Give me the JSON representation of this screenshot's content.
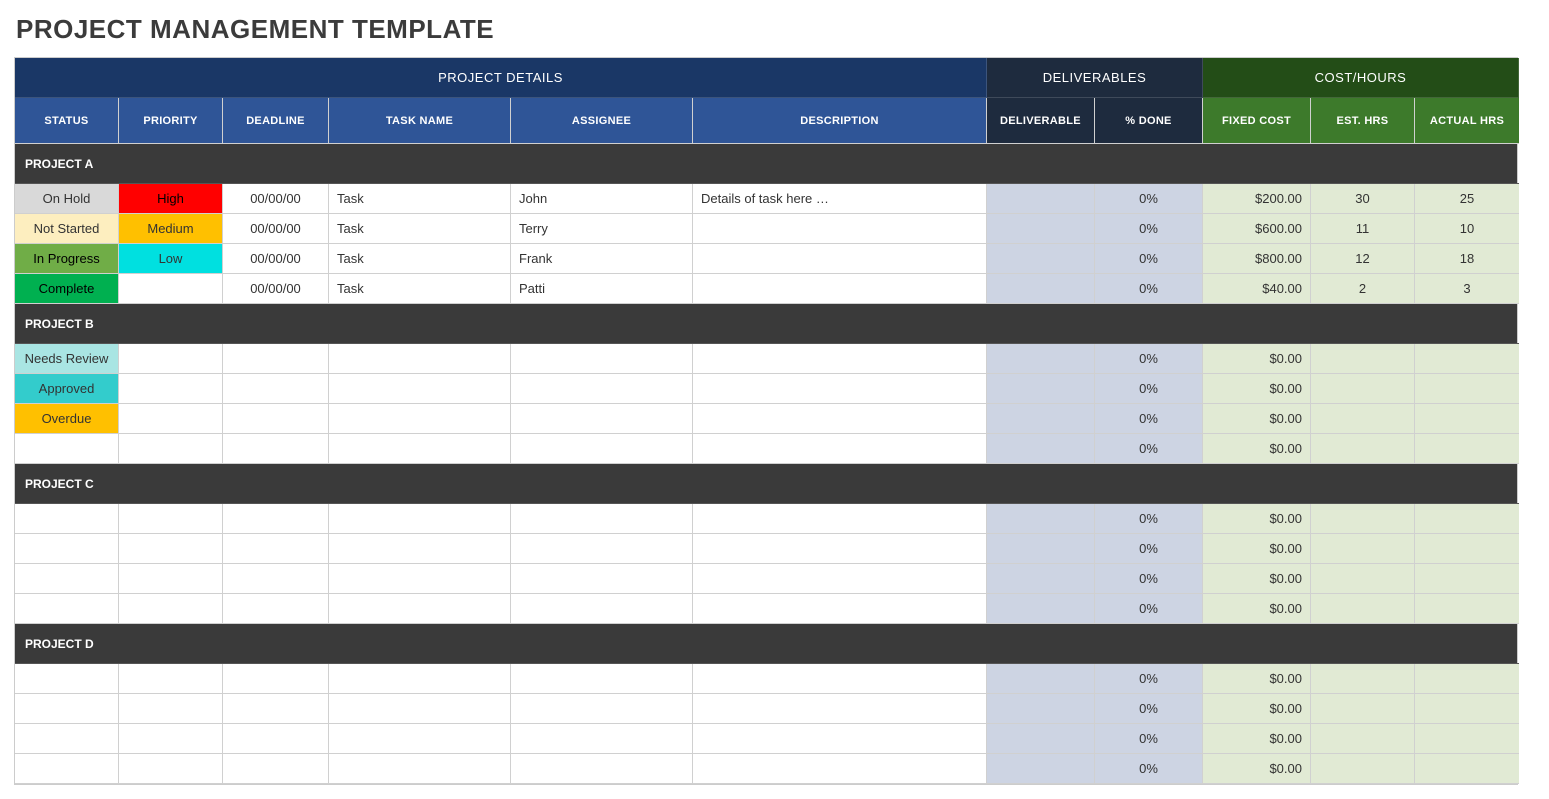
{
  "title": "PROJECT MANAGEMENT TEMPLATE",
  "bands": {
    "pd": "PROJECT DETAILS",
    "del": "DELIVERABLES",
    "cost": "COST/HOURS"
  },
  "cols": {
    "status": "STATUS",
    "priority": "PRIORITY",
    "deadline": "DEADLINE",
    "task": "TASK NAME",
    "assignee": "ASSIGNEE",
    "desc": "DESCRIPTION",
    "deliv": "DELIVERABLE",
    "done": "% DONE",
    "fixed": "FIXED COST",
    "est": "EST. HRS",
    "actual": "ACTUAL HRS"
  },
  "status_classes": {
    "On Hold": "sOnHold",
    "Not Started": "sNotStarted",
    "In Progress": "sInProgress",
    "Complete": "sComplete",
    "Needs Review": "sNeedsReview",
    "Approved": "sApproved",
    "Overdue": "sOverdue"
  },
  "priority_classes": {
    "High": "pHigh",
    "Medium": "pMedium",
    "Low": "pLow"
  },
  "projects": [
    {
      "name": "PROJECT A",
      "rows": [
        {
          "status": "On Hold",
          "priority": "High",
          "deadline": "00/00/00",
          "task": "Task",
          "assignee": "John",
          "desc": "Details of task here …",
          "deliv": "",
          "done": "0%",
          "fixed": "$200.00",
          "est": "30",
          "actual": "25"
        },
        {
          "status": "Not Started",
          "priority": "Medium",
          "deadline": "00/00/00",
          "task": "Task",
          "assignee": "Terry",
          "desc": "",
          "deliv": "",
          "done": "0%",
          "fixed": "$600.00",
          "est": "11",
          "actual": "10"
        },
        {
          "status": "In Progress",
          "priority": "Low",
          "deadline": "00/00/00",
          "task": "Task",
          "assignee": "Frank",
          "desc": "",
          "deliv": "",
          "done": "0%",
          "fixed": "$800.00",
          "est": "12",
          "actual": "18"
        },
        {
          "status": "Complete",
          "priority": "",
          "deadline": "00/00/00",
          "task": "Task",
          "assignee": "Patti",
          "desc": "",
          "deliv": "",
          "done": "0%",
          "fixed": "$40.00",
          "est": "2",
          "actual": "3"
        }
      ]
    },
    {
      "name": "PROJECT B",
      "rows": [
        {
          "status": "Needs Review",
          "priority": "",
          "deadline": "",
          "task": "",
          "assignee": "",
          "desc": "",
          "deliv": "",
          "done": "0%",
          "fixed": "$0.00",
          "est": "",
          "actual": ""
        },
        {
          "status": "Approved",
          "priority": "",
          "deadline": "",
          "task": "",
          "assignee": "",
          "desc": "",
          "deliv": "",
          "done": "0%",
          "fixed": "$0.00",
          "est": "",
          "actual": ""
        },
        {
          "status": "Overdue",
          "priority": "",
          "deadline": "",
          "task": "",
          "assignee": "",
          "desc": "",
          "deliv": "",
          "done": "0%",
          "fixed": "$0.00",
          "est": "",
          "actual": ""
        },
        {
          "status": "",
          "priority": "",
          "deadline": "",
          "task": "",
          "assignee": "",
          "desc": "",
          "deliv": "",
          "done": "0%",
          "fixed": "$0.00",
          "est": "",
          "actual": ""
        }
      ]
    },
    {
      "name": "PROJECT C",
      "rows": [
        {
          "status": "",
          "priority": "",
          "deadline": "",
          "task": "",
          "assignee": "",
          "desc": "",
          "deliv": "",
          "done": "0%",
          "fixed": "$0.00",
          "est": "",
          "actual": ""
        },
        {
          "status": "",
          "priority": "",
          "deadline": "",
          "task": "",
          "assignee": "",
          "desc": "",
          "deliv": "",
          "done": "0%",
          "fixed": "$0.00",
          "est": "",
          "actual": ""
        },
        {
          "status": "",
          "priority": "",
          "deadline": "",
          "task": "",
          "assignee": "",
          "desc": "",
          "deliv": "",
          "done": "0%",
          "fixed": "$0.00",
          "est": "",
          "actual": ""
        },
        {
          "status": "",
          "priority": "",
          "deadline": "",
          "task": "",
          "assignee": "",
          "desc": "",
          "deliv": "",
          "done": "0%",
          "fixed": "$0.00",
          "est": "",
          "actual": ""
        }
      ]
    },
    {
      "name": "PROJECT D",
      "rows": [
        {
          "status": "",
          "priority": "",
          "deadline": "",
          "task": "",
          "assignee": "",
          "desc": "",
          "deliv": "",
          "done": "0%",
          "fixed": "$0.00",
          "est": "",
          "actual": ""
        },
        {
          "status": "",
          "priority": "",
          "deadline": "",
          "task": "",
          "assignee": "",
          "desc": "",
          "deliv": "",
          "done": "0%",
          "fixed": "$0.00",
          "est": "",
          "actual": ""
        },
        {
          "status": "",
          "priority": "",
          "deadline": "",
          "task": "",
          "assignee": "",
          "desc": "",
          "deliv": "",
          "done": "0%",
          "fixed": "$0.00",
          "est": "",
          "actual": ""
        },
        {
          "status": "",
          "priority": "",
          "deadline": "",
          "task": "",
          "assignee": "",
          "desc": "",
          "deliv": "",
          "done": "0%",
          "fixed": "$0.00",
          "est": "",
          "actual": ""
        }
      ]
    }
  ]
}
